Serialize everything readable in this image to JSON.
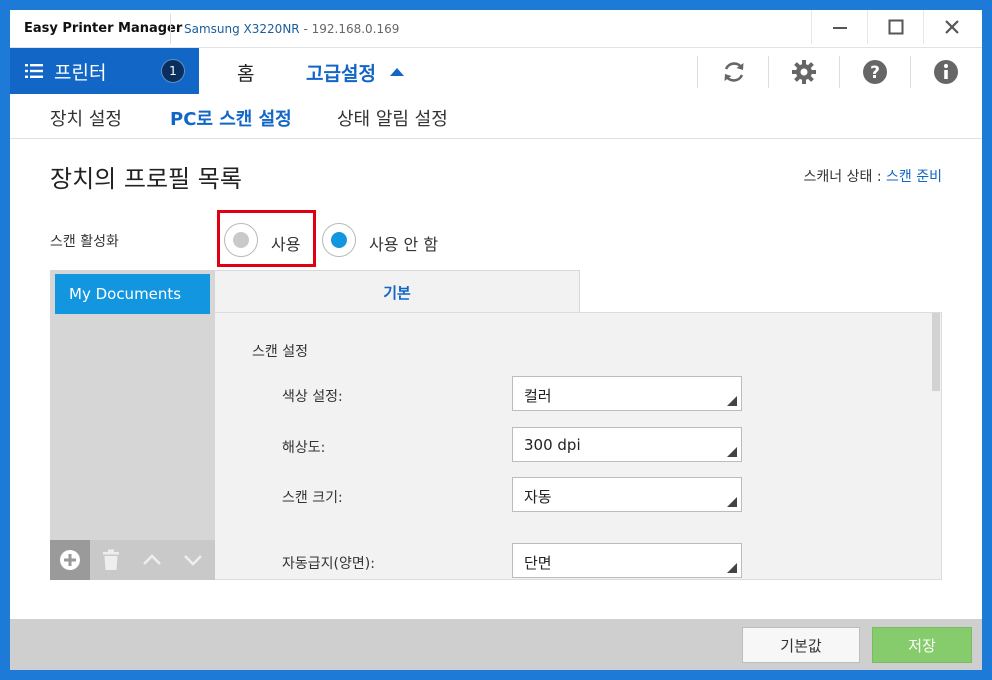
{
  "titlebar": {
    "app_name": "Easy Printer Manager",
    "device_model": "Samsung X3220NR",
    "device_ip": " - 192.168.0.169"
  },
  "nav": {
    "printer_label": "프린터",
    "printer_count": "1",
    "home_label": "홈",
    "advanced_label": "고급설정"
  },
  "subtabs": [
    "장치 설정",
    "PC로 스캔 설정",
    "상태 알림 설정"
  ],
  "page": {
    "title": "장치의 프로필 목록",
    "scanner_status_label": "스캐너 상태 : ",
    "scanner_status_value": "스캔 준비"
  },
  "scan_enable": {
    "label": "스캔 활성화",
    "option_on": "사용",
    "option_off": "사용 안 함",
    "selected": "사용 안 함"
  },
  "profiles": [
    "My Documents"
  ],
  "detail": {
    "tab_label": "기본",
    "section_title": "스캔 설정",
    "fields": [
      {
        "label": "색상 설정:",
        "value": "컬러"
      },
      {
        "label": "해상도:",
        "value": "300 dpi"
      },
      {
        "label": "스캔 크기:",
        "value": "자동"
      },
      {
        "label": "자동급지(양면):",
        "value": "단면"
      }
    ]
  },
  "footer": {
    "default_label": "기본값",
    "save_label": "저장"
  },
  "colors": {
    "accent": "#1266c5",
    "profile_selected": "#1196df",
    "save_button": "#86cc6c",
    "highlight": "#e00012"
  }
}
